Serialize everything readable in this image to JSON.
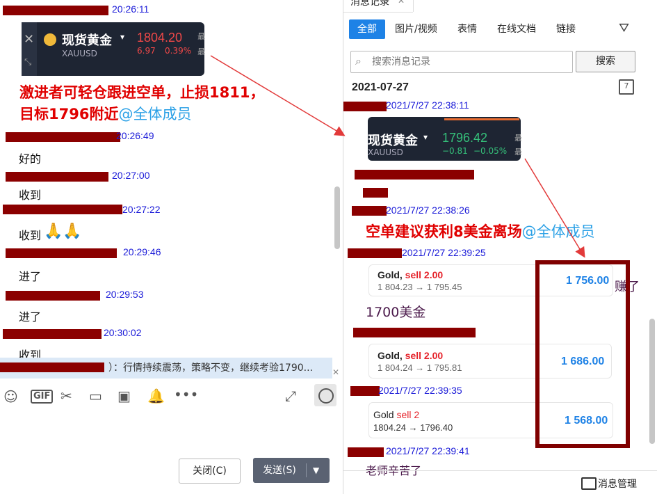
{
  "left": {
    "messages": [
      {
        "time": "20:26:11"
      },
      {
        "time": "20:26:49",
        "text": "好的"
      },
      {
        "time": "20:27:00",
        "text": "收到"
      },
      {
        "time": "20:27:22",
        "text": "收到"
      },
      {
        "time": "20:29:46",
        "text": "进了"
      },
      {
        "time": "20:29:53",
        "text": "进了"
      },
      {
        "time": "20:30:02",
        "text": "收到"
      }
    ],
    "gold_card": {
      "name": "现货黄金",
      "symbol": "XAUUSD",
      "price": "1804.20",
      "change": "6.97",
      "change_pct": "0.39%",
      "side_char1": "最",
      "side_char2": "最"
    },
    "annotation": {
      "line1": "激进者可轻仓跟进空单，止损1811，",
      "line2": "目标1796附近",
      "mention": "@全体成员"
    },
    "quote": {
      "text": "）：行情持续震荡，策略不变，继续考验1790..."
    },
    "buttons": {
      "close": "关闭(C)",
      "send": "发送(S)"
    }
  },
  "right": {
    "tab_title": "消息记录",
    "filters": [
      "全部",
      "图片/视频",
      "表情",
      "在线文档",
      "链接"
    ],
    "search_placeholder": "搜索消息记录",
    "search_button": "搜索",
    "date": "2021-07-27",
    "calendar_day": "7",
    "gold_card": {
      "name": "现货黄金",
      "symbol": "XAUUSD",
      "price": "1796.42",
      "change": "−0.81",
      "change_pct": "−0.05%",
      "side_char1": "最",
      "side_char2": "最"
    },
    "messages": [
      {
        "time": "2021/7/27 22:38:11"
      },
      {
        "time": "2021/7/27 22:38:26"
      },
      {
        "time": "2021/7/27 22:39:25"
      },
      {
        "time": "2021/7/27 22:39:35"
      },
      {
        "time": "2021/7/27 22:39:41",
        "text": "老师辛苦了"
      }
    ],
    "annotation": {
      "text": "空单建议获利8美金离场",
      "mention": "@全体成员"
    },
    "trades": [
      {
        "title": "Gold,",
        "side": "sell 2.00",
        "range": "1 804.23 → 1 795.45",
        "profit": "1 756.00"
      },
      {
        "title": "Gold,",
        "side": "sell 2.00",
        "range": "1 804.24 → 1 795.81",
        "profit": "1 686.00"
      },
      {
        "title": "Gold",
        "side": "sell 2",
        "range": "1804.24 → 1796.40",
        "profit": "1 568.00"
      }
    ],
    "earn_text": "赚了",
    "amount_text": "1700美金",
    "footer_label": "消息管理"
  },
  "colors": {
    "accent": "#1e82e6",
    "annotation_red": "#e00000",
    "redact": "#8b0000",
    "mention": "#2aa0e6"
  }
}
